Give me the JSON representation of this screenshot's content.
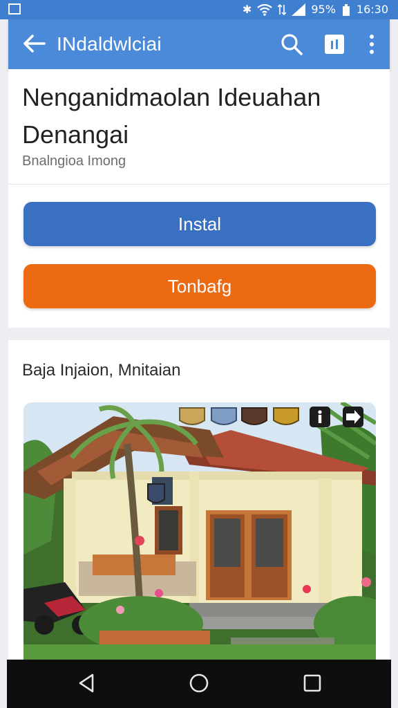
{
  "status_bar": {
    "battery": "95%",
    "time": "16:30"
  },
  "app_bar": {
    "title": "INdaldwlciai"
  },
  "header_card": {
    "title": "Nenganidmaolan Ideuahan Denangai",
    "subtitle": "Bnalngioa Imong",
    "primary_button": "Instal",
    "secondary_button": "Tonbafg"
  },
  "gallery_card": {
    "heading": "Baja Injaion, Mnitaian"
  },
  "colors": {
    "app_bar": "#4a8ad8",
    "primary": "#3a70c2",
    "secondary": "#ec6a12"
  }
}
